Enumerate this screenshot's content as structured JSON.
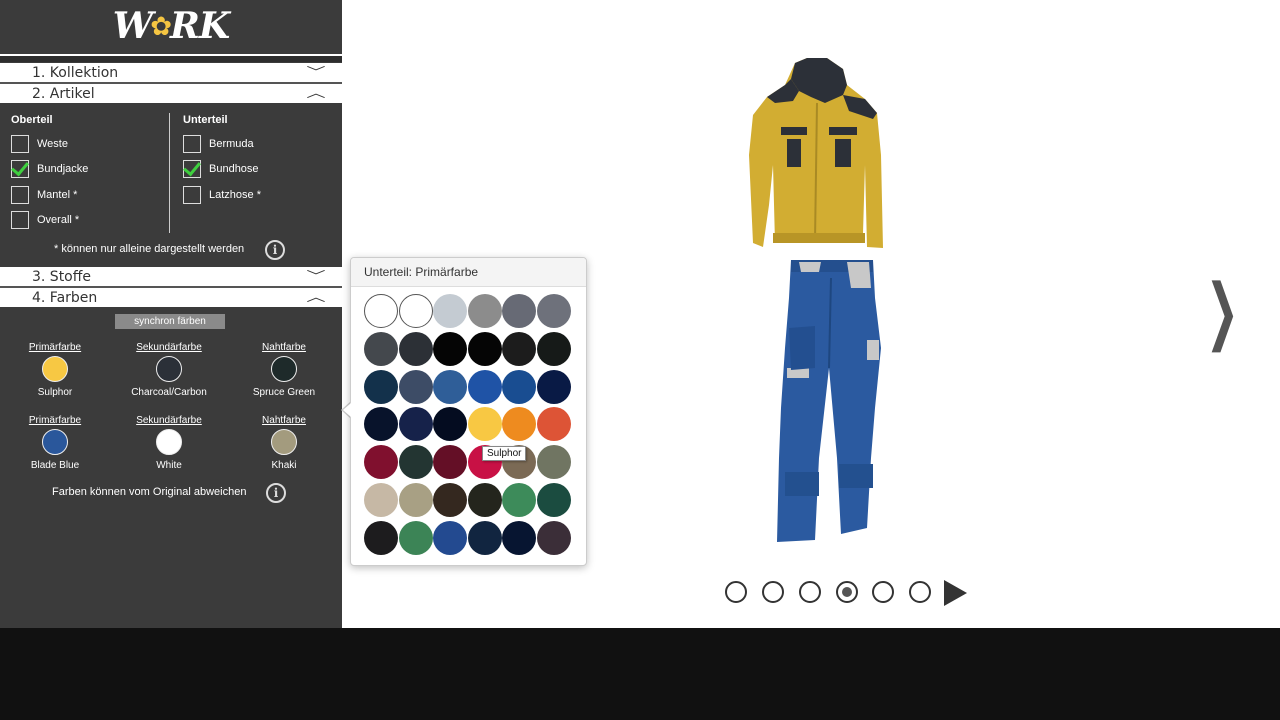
{
  "logo": {
    "left": "W",
    "flower": "✿",
    "right": "RK"
  },
  "sections": [
    {
      "label": "1. Kollektion",
      "state": "collapsed"
    },
    {
      "label": "2. Artikel",
      "state": "expanded"
    },
    {
      "label": "3. Stoffe",
      "state": "collapsed"
    },
    {
      "label": "4. Farben",
      "state": "expanded"
    }
  ],
  "artikel": {
    "oberteil_title": "Oberteil",
    "unterteil_title": "Unterteil",
    "oberteil": [
      {
        "label": "Weste",
        "checked": false
      },
      {
        "label": "Bundjacke",
        "checked": true
      },
      {
        "label": "Mantel *",
        "checked": false
      },
      {
        "label": "Overall *",
        "checked": false
      }
    ],
    "unterteil": [
      {
        "label": "Bermuda",
        "checked": false
      },
      {
        "label": "Bundhose",
        "checked": true
      },
      {
        "label": "Latzhose *",
        "checked": false
      }
    ],
    "note": "* können nur alleine dargestellt werden"
  },
  "farben": {
    "sync_label": "synchron färben",
    "rows": [
      [
        {
          "title": "Primärfarbe",
          "name": "Sulphor",
          "color": "#f7c843"
        },
        {
          "title": "Sekundärfarbe",
          "name": "Charcoal/Carbon",
          "color": "#2b3038"
        },
        {
          "title": "Nahtfarbe",
          "name": "Spruce Green",
          "color": "#1e2a2a"
        }
      ],
      [
        {
          "title": "Primärfarbe",
          "name": "Blade Blue",
          "color": "#2a579b"
        },
        {
          "title": "Sekundärfarbe",
          "name": "White",
          "color": "#ffffff"
        },
        {
          "title": "Nahtfarbe",
          "name": "Khaki",
          "color": "#a39b7e"
        }
      ]
    ],
    "note": "Farben können vom Original abweichen"
  },
  "popup": {
    "title": "Unterteil: Primärfarbe",
    "tooltip": "Sulphor",
    "swatches": [
      "#ffffff",
      "#ffffff",
      "#c4cbd2",
      "#8c8c8c",
      "#676a75",
      "#6e717b",
      "#44484d",
      "#2c3036",
      "#050505",
      "#050505",
      "#1c1c1c",
      "#161a18",
      "#13314b",
      "#3d4c66",
      "#2f5e98",
      "#1f53a6",
      "#194d91",
      "#091a45",
      "#08132b",
      "#16224a",
      "#040c20",
      "#f8c843",
      "#ee8b1f",
      "#dd5436",
      "#80102e",
      "#233532",
      "#640f26",
      "#c81145",
      "#7b6a55",
      "#707562",
      "#c6b8a5",
      "#a8a084",
      "#34281f",
      "#24251d",
      "#3d8b5a",
      "#1b4c40",
      "#1d1c1e",
      "#3c8456",
      "#234a90",
      "#112540",
      "#071531",
      "#3b2e38"
    ]
  },
  "carousel": {
    "dots": 6,
    "active_index": 3
  }
}
